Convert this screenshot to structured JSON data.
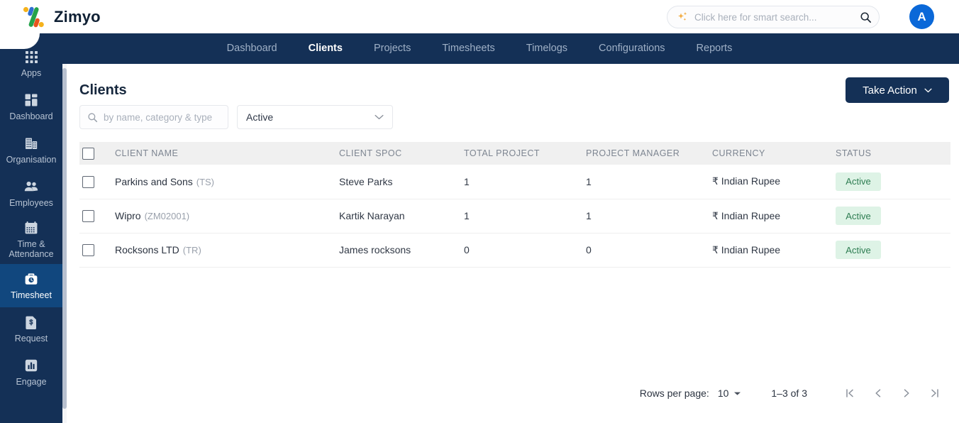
{
  "brand": {
    "name": "Zimyo",
    "logo_icon": "zimyo-percent-logo"
  },
  "topbar": {
    "smart_search": {
      "placeholder": "Click here for smart search...",
      "value": "",
      "sparkle_icon": "sparkle-icon",
      "search_icon": "search-icon"
    },
    "avatar_initial": "A",
    "avatar_color": "#0a68d8"
  },
  "nav": {
    "items": [
      {
        "label": "Dashboard",
        "active": false
      },
      {
        "label": "Clients",
        "active": true
      },
      {
        "label": "Projects",
        "active": false
      },
      {
        "label": "Timesheets",
        "active": false
      },
      {
        "label": "Timelogs",
        "active": false
      },
      {
        "label": "Configurations",
        "active": false
      },
      {
        "label": "Reports",
        "active": false
      }
    ],
    "background": "#143056"
  },
  "sidebar": {
    "items": [
      {
        "label": "Apps",
        "icon": "grid-dots-icon",
        "active": false
      },
      {
        "label": "Dashboard",
        "icon": "dashboard-blocks-icon",
        "active": false
      },
      {
        "label": "Organisation",
        "icon": "building-icon",
        "active": false
      },
      {
        "label": "Employees",
        "icon": "people-icon",
        "active": false
      },
      {
        "label": "Time & Attendance",
        "icon": "calendar-icon",
        "active": false
      },
      {
        "label": "Timesheet",
        "icon": "briefcase-clock-icon",
        "active": true
      },
      {
        "label": "Request",
        "icon": "document-dollar-icon",
        "active": false
      },
      {
        "label": "Engage",
        "icon": "bar-chart-icon",
        "active": false
      }
    ],
    "active_color": "#11477e"
  },
  "main": {
    "title": "Clients",
    "take_action_label": "Take Action",
    "search": {
      "placeholder": "by name, category & type",
      "value": ""
    },
    "status_filter": {
      "value": "Active"
    }
  },
  "table": {
    "headers": [
      "CLIENT NAME",
      "CLIENT SPOC",
      "TOTAL PROJECT",
      "PROJECT MANAGER",
      "CURRENCY",
      "STATUS"
    ],
    "rows": [
      {
        "name": "Parkins and Sons",
        "code": "(TS)",
        "spoc": "Steve Parks",
        "total_project": "1",
        "project_manager": "1",
        "currency": "₹ Indian Rupee",
        "status": "Active"
      },
      {
        "name": "Wipro",
        "code": "(ZM02001)",
        "spoc": "Kartik Narayan",
        "total_project": "1",
        "project_manager": "1",
        "currency": "₹ Indian Rupee",
        "status": "Active"
      },
      {
        "name": "Rocksons LTD",
        "code": "(TR)",
        "spoc": "James rocksons",
        "total_project": "0",
        "project_manager": "0",
        "currency": "₹ Indian Rupee",
        "status": "Active"
      }
    ],
    "status_badge_bg": "#def3e6",
    "status_badge_color": "#2e7d52"
  },
  "pagination": {
    "rows_per_page_label": "Rows per page:",
    "rows_per_page_value": "10",
    "range": "1–3 of 3"
  }
}
